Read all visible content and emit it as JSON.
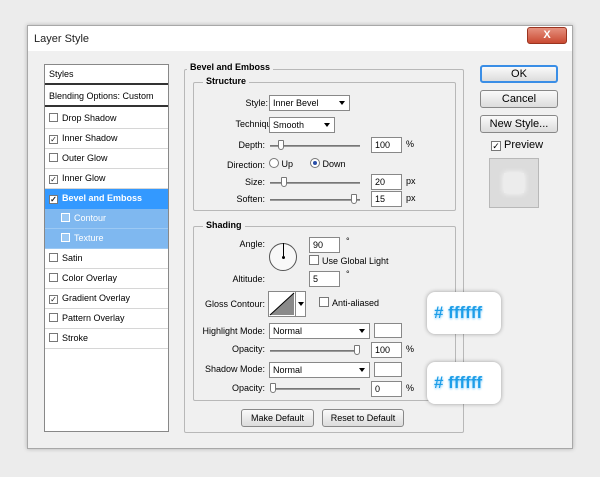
{
  "window": {
    "title": "Layer Style",
    "close_label": "X"
  },
  "styles_list": {
    "header": "Styles",
    "blending": "Blending Options: Custom",
    "items": [
      {
        "label": "Drop Shadow",
        "checked": false
      },
      {
        "label": "Inner Shadow",
        "checked": true
      },
      {
        "label": "Outer Glow",
        "checked": false
      },
      {
        "label": "Inner Glow",
        "checked": true
      },
      {
        "label": "Bevel and Emboss",
        "checked": true
      },
      {
        "label": "Contour",
        "checked": false
      },
      {
        "label": "Texture",
        "checked": false
      },
      {
        "label": "Satin",
        "checked": false
      },
      {
        "label": "Color Overlay",
        "checked": false
      },
      {
        "label": "Gradient Overlay",
        "checked": true
      },
      {
        "label": "Pattern Overlay",
        "checked": false
      },
      {
        "label": "Stroke",
        "checked": false
      }
    ]
  },
  "bevel": {
    "title": "Bevel and Emboss",
    "structure": {
      "title": "Structure",
      "style_label": "Style:",
      "style_value": "Inner Bevel",
      "technique_label": "Technique:",
      "technique_value": "Smooth",
      "depth_label": "Depth:",
      "depth_value": "100",
      "depth_unit": "%",
      "depth_level": 0.1,
      "direction_label": "Direction:",
      "direction_up": "Up",
      "direction_down": "Down",
      "size_label": "Size:",
      "size_value": "20",
      "size_unit": "px",
      "size_level": 0.13,
      "soften_label": "Soften:",
      "soften_value": "15",
      "soften_unit": "px",
      "soften_level": 0.97
    },
    "shading": {
      "title": "Shading",
      "angle_label": "Angle:",
      "angle_value": "90",
      "angle_unit": "°",
      "global_light": "Use Global Light",
      "altitude_label": "Altitude:",
      "altitude_value": "5",
      "altitude_unit": "°",
      "gloss_label": "Gloss Contour:",
      "anti_aliased": "Anti-aliased",
      "highlight_mode_label": "Highlight Mode:",
      "highlight_mode": "Normal",
      "highlight_opacity_label": "Opacity:",
      "highlight_opacity": "100",
      "highlight_opacity_unit": "%",
      "highlight_opacity_level": 1.0,
      "highlight_color": "#ffffff",
      "shadow_mode_label": "Shadow Mode:",
      "shadow_mode": "Normal",
      "shadow_opacity_label": "Opacity:",
      "shadow_opacity": "0",
      "shadow_opacity_unit": "%",
      "shadow_opacity_level": 0.0,
      "shadow_color": "#ffffff"
    },
    "make_default": "Make Default",
    "reset_default": "Reset to Default"
  },
  "buttons": {
    "ok": "OK",
    "cancel": "Cancel",
    "new_style": "New Style...",
    "preview": "Preview"
  },
  "annotations": {
    "highlight_hex": "# ffffff",
    "shadow_hex": "# ffffff"
  },
  "colors": {
    "accent": "#3399ff",
    "hex_text": "#1e9ee8"
  }
}
